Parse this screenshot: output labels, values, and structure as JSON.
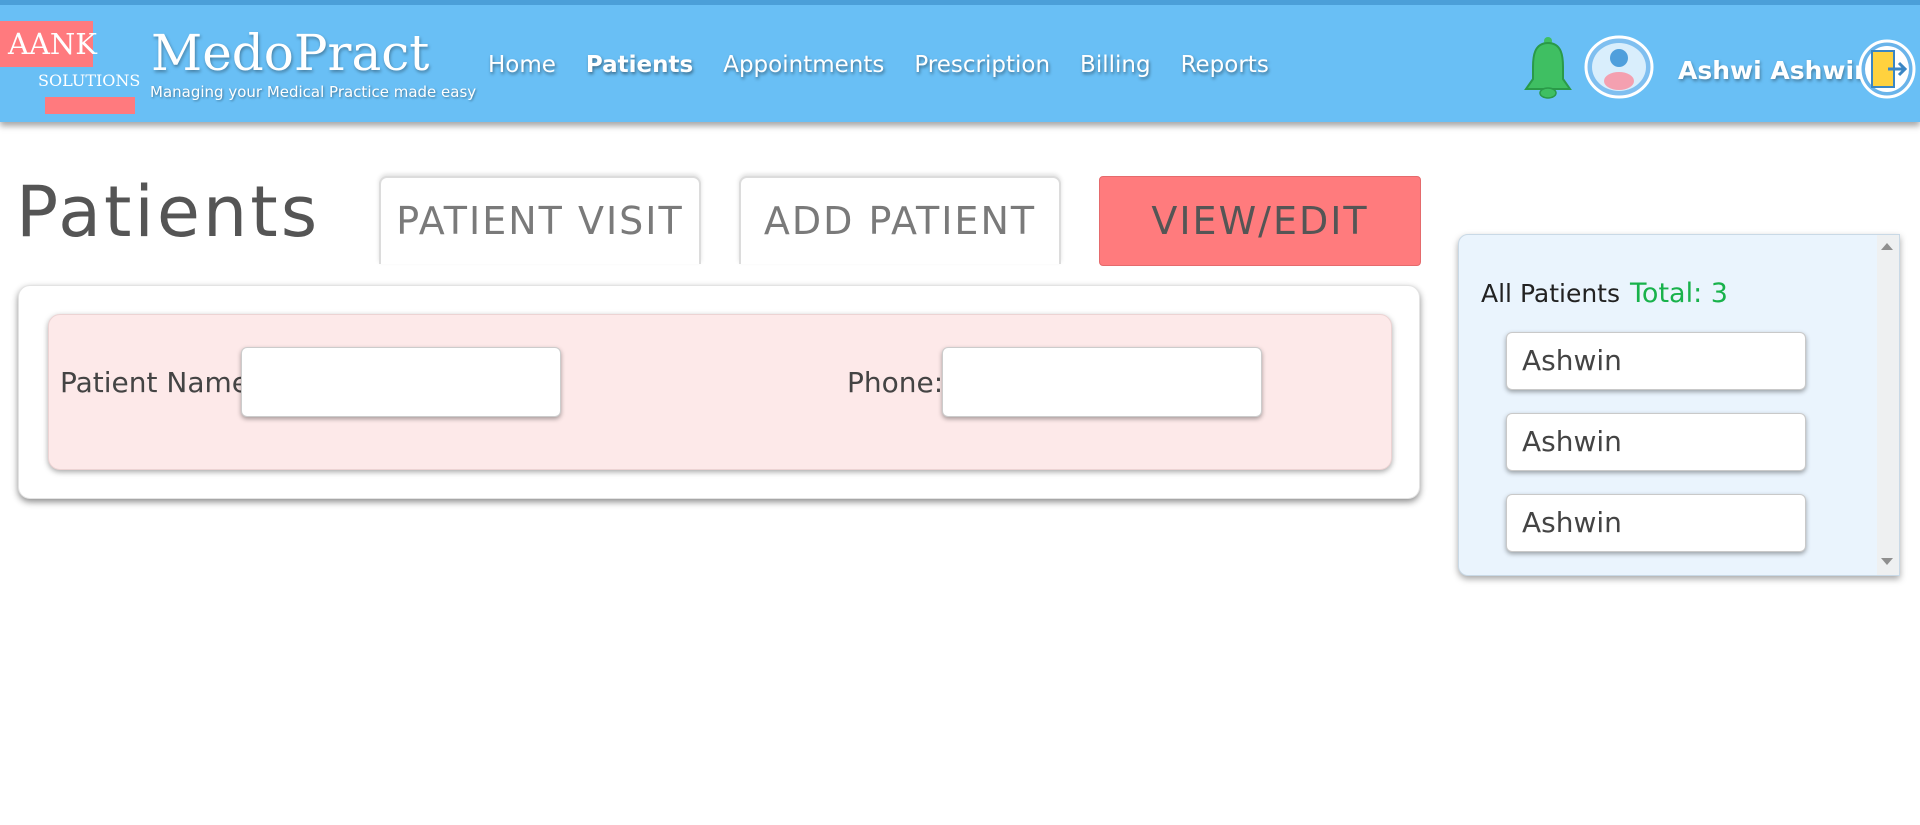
{
  "header": {
    "logo": {
      "line1": "AANK",
      "line2": "SOLUTIONS"
    },
    "brand": "MedoPract",
    "tagline": "Managing your Medical Practice made easy",
    "nav": [
      {
        "label": "Home",
        "active": false
      },
      {
        "label": "Patients",
        "active": true
      },
      {
        "label": "Appointments",
        "active": false
      },
      {
        "label": "Prescription",
        "active": false
      },
      {
        "label": "Billing",
        "active": false
      },
      {
        "label": "Reports",
        "active": false
      }
    ],
    "user_name": "Ashwi  Ashwin"
  },
  "page": {
    "title": "Patients",
    "tabs": {
      "patient_visit": "PATIENT VISIT",
      "add_patient": "ADD PATIENT",
      "view_edit": "VIEW/EDIT"
    }
  },
  "search": {
    "patient_name_label": "Patient Name:",
    "patient_name_value": "",
    "phone_label": "Phone:",
    "phone_value": ""
  },
  "patient_list": {
    "heading": "All Patients",
    "total": "Total: 3",
    "items": [
      "Ashwin",
      "Ashwin",
      "Ashwin"
    ]
  },
  "colors": {
    "header_bg": "#69bff5",
    "accent_red": "#ff7b7d",
    "total_green": "#19b24b",
    "search_panel_bg": "#fde9e9",
    "list_panel_bg": "#eaf4fd"
  }
}
